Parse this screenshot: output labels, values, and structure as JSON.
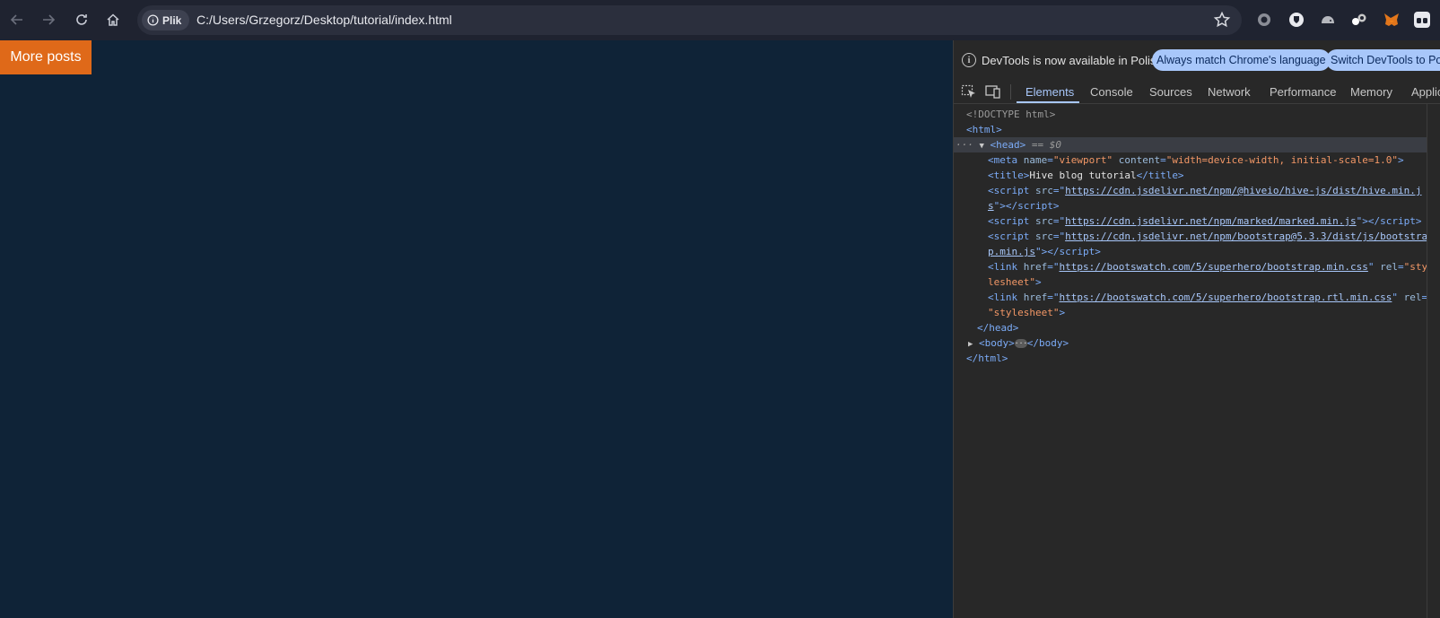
{
  "browser": {
    "chip_label": "Plik",
    "url": "C:/Users/Grzegorz/Desktop/tutorial/index.html"
  },
  "page": {
    "more_posts_label": "More posts",
    "background_color": "#0f2337",
    "button_color": "#df6919"
  },
  "devtools": {
    "info_text": "DevTools is now available in Polish!",
    "btn_match_language": "Always match Chrome's language",
    "btn_switch_polish": "Switch DevTools to Pol",
    "tabs": [
      "Elements",
      "Console",
      "Sources",
      "Network",
      "Performance",
      "Memory",
      "Applic"
    ],
    "dom": {
      "doctype": "<!DOCTYPE html>",
      "html_open": "<html>",
      "head_open": "<head>",
      "head_marker": " == $0",
      "meta_name_attr": "name",
      "meta_name_val": "\"viewport\"",
      "meta_content_attr": "content",
      "meta_content_val": "\"width=device-width, initial-scale=1.0\"",
      "title_text": "Hive blog tutorial",
      "script1_src_a": "https://cdn.jsdelivr.net/npm/@hiveio/hive-js/dist/hive.min.j",
      "script1_src_b": "s",
      "script2_src": "https://cdn.jsdelivr.net/npm/marked/marked.min.js",
      "script3_src_a": "https://cdn.jsdelivr.net/npm/bootstrap@5.3.3/dist/js/bootstra",
      "script3_src_b": "p.min.js",
      "link1_href": "https://bootswatch.com/5/superhero/bootstrap.min.css",
      "link1_rel_a": "\"sty",
      "link1_rel_b": "lesheet\"",
      "link2_href": "https://bootswatch.com/5/superhero/bootstrap.rtl.min.css",
      "link2_rel": "\"stylesheet\"",
      "head_close": "</head>",
      "body_open": "<body>",
      "body_close": "</body>",
      "html_close": "</html>"
    }
  }
}
